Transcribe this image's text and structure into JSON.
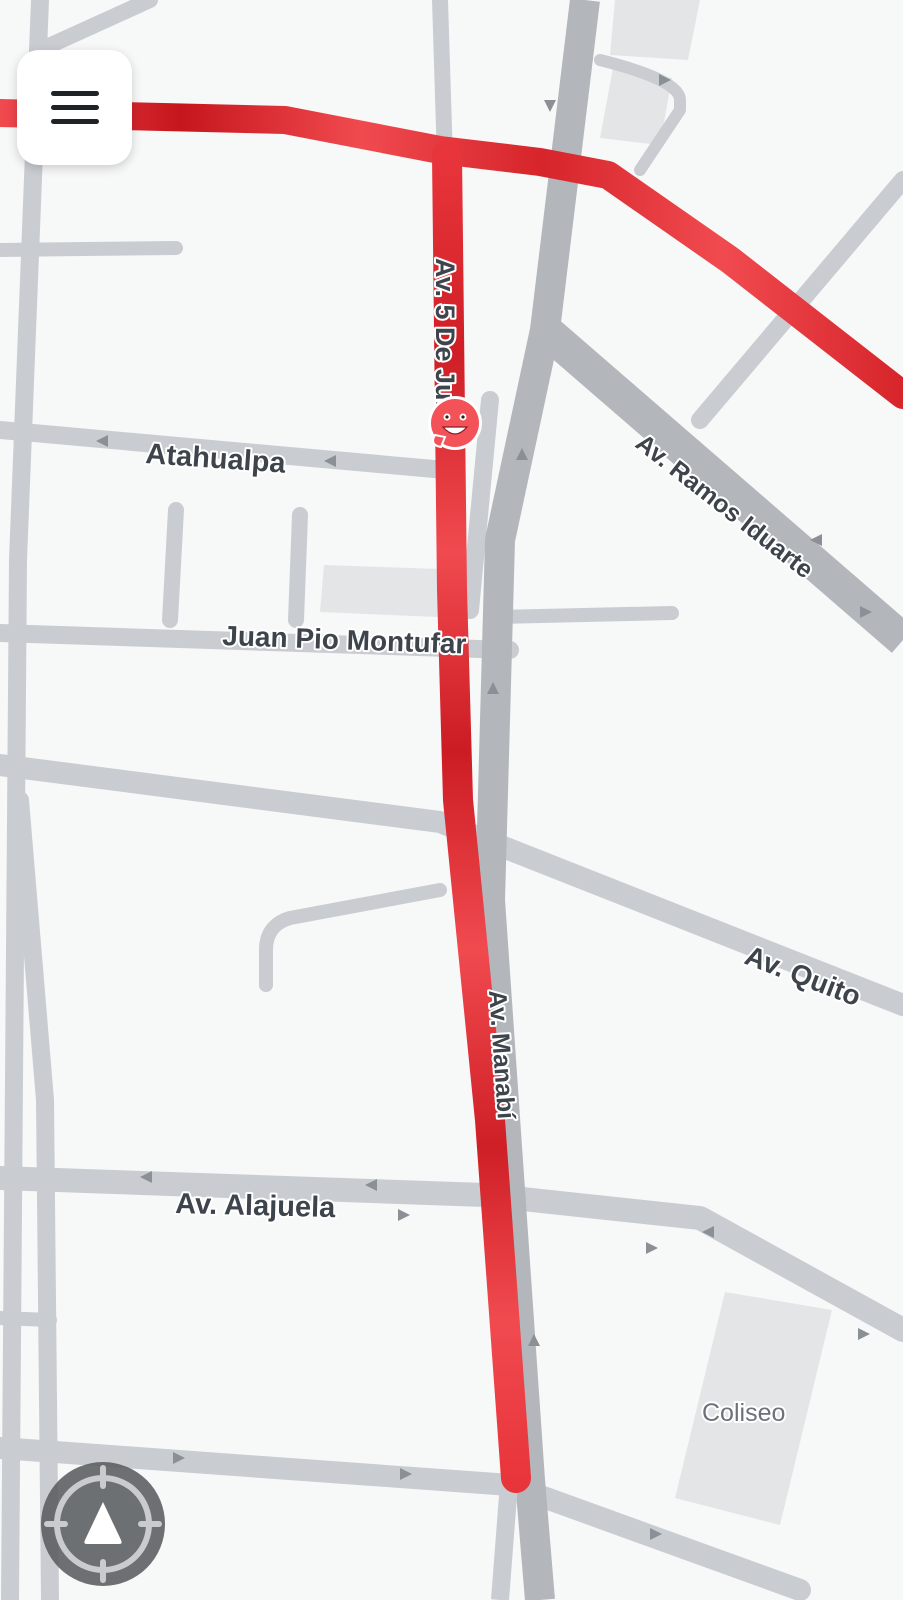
{
  "map": {
    "streets": {
      "av_5_de_junio": "Av. 5 De Junio",
      "atahualpa": "Atahualpa",
      "av_ramos_iduarte": "Av. Ramos Iduarte",
      "juan_pio_montufar": "Juan Pio Montufar",
      "av_quito": "Av. Quito",
      "av_manabi": "Av. Manabí",
      "av_alajuela": "Av. Alajuela"
    },
    "poi": {
      "coliseo": "Coliseo"
    },
    "colors": {
      "background": "#f7f8f8",
      "road": "#c9cdd2",
      "major_road": "#b3b7bc",
      "traffic_heavy": "#e8353b",
      "traffic_dark": "#c6161d",
      "poi_area": "#e3e5e7",
      "label": "#3d444c"
    }
  },
  "controls": {
    "menu_icon": "hamburger-menu-icon",
    "locate_icon": "recenter-location-icon",
    "reporter_icon": "wazer-smiley-icon"
  }
}
